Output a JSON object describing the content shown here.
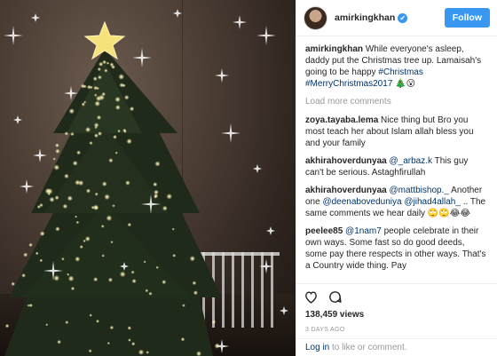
{
  "header": {
    "username": "amirkingkhan",
    "verified_badge": "✔",
    "follow_label": "Follow"
  },
  "caption": {
    "author": "amirkingkhan",
    "text": "While everyone's asleep, daddy put the Christmas tree up. Lamaisah's going to be happy",
    "tag1": "#Christmas",
    "tag2": "#MerryChristmas2017",
    "emoji": "🎄😮"
  },
  "load_more_label": "Load more comments",
  "comments": [
    {
      "author": "zoya.tayaba.lema",
      "pre": "Nice thing but Bro you most teach her about Islam allah bless you and your family",
      "tag": "",
      "post": ""
    },
    {
      "author": "akhirahoverdunyaa",
      "pre": "",
      "tag": "@_arbaz.k",
      "post": "This guy can't be serious. Astaghfirullah"
    },
    {
      "author": "akhirahoverdunyaa",
      "pre": "",
      "tag": "@mattbishop._",
      "post": "Another one"
    },
    {
      "author": "peelee85",
      "pre": "",
      "tag": "@1nam7",
      "post": "people celebrate in their own ways. Some fast so do good deeds, some pay there respects in other ways. That's a Country wide thing. Pay"
    }
  ],
  "comment3_extra": {
    "tag2": "@deenaboveduniya",
    "tag3": "@jihad4allah_",
    "text": ".. The same comments we hear daily 🙄🙄😂😂"
  },
  "actions": {
    "like_icon": "heart-icon",
    "comment_icon": "comment-icon"
  },
  "views": "138,459 views",
  "time": "3 DAYS AGO",
  "login": {
    "link": "Log in",
    "rest": "to like or comment."
  }
}
